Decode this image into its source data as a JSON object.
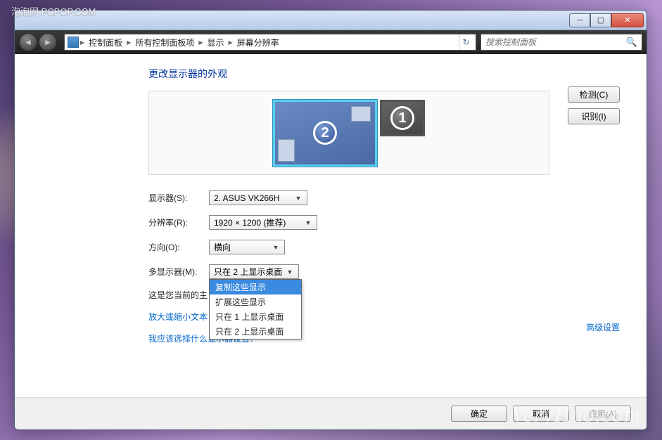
{
  "watermarks": {
    "top": "泡泡网 PCPOP.COM",
    "bottom": "VeryHuo.com"
  },
  "breadcrumbs": [
    {
      "label": "控制面板"
    },
    {
      "label": "所有控制面板项"
    },
    {
      "label": "显示"
    },
    {
      "label": "屏幕分辨率"
    }
  ],
  "search": {
    "placeholder": "搜索控制面板"
  },
  "page_title": "更改显示器的外观",
  "monitors": {
    "primary_num": "2",
    "secondary_num": "1"
  },
  "side_buttons": {
    "detect": "检测(C)",
    "identify": "识别(I)"
  },
  "form": {
    "display_label": "显示器(S):",
    "display_value": "2. ASUS VK266H",
    "resolution_label": "分辨率(R):",
    "resolution_value": "1920 × 1200 (推荐)",
    "orientation_label": "方向(O):",
    "orientation_value": "横向",
    "multidisplay_label": "多显示器(M):",
    "multidisplay_value": "只在 2 上显示桌面"
  },
  "dropdown_items": [
    {
      "label": "复制这些显示",
      "selected": true
    },
    {
      "label": "扩展这些显示",
      "selected": false
    },
    {
      "label": "只在 1 上显示桌面",
      "selected": false
    },
    {
      "label": "只在 2 上显示桌面",
      "selected": false
    }
  ],
  "info_text": "这是您当前的主",
  "links": {
    "textsize": "放大或缩小文本",
    "whichdisplay": "我应该选择什么显示器设置？",
    "advanced": "高级设置"
  },
  "buttons": {
    "ok": "确定",
    "cancel": "取消",
    "apply": "应用(A)"
  }
}
